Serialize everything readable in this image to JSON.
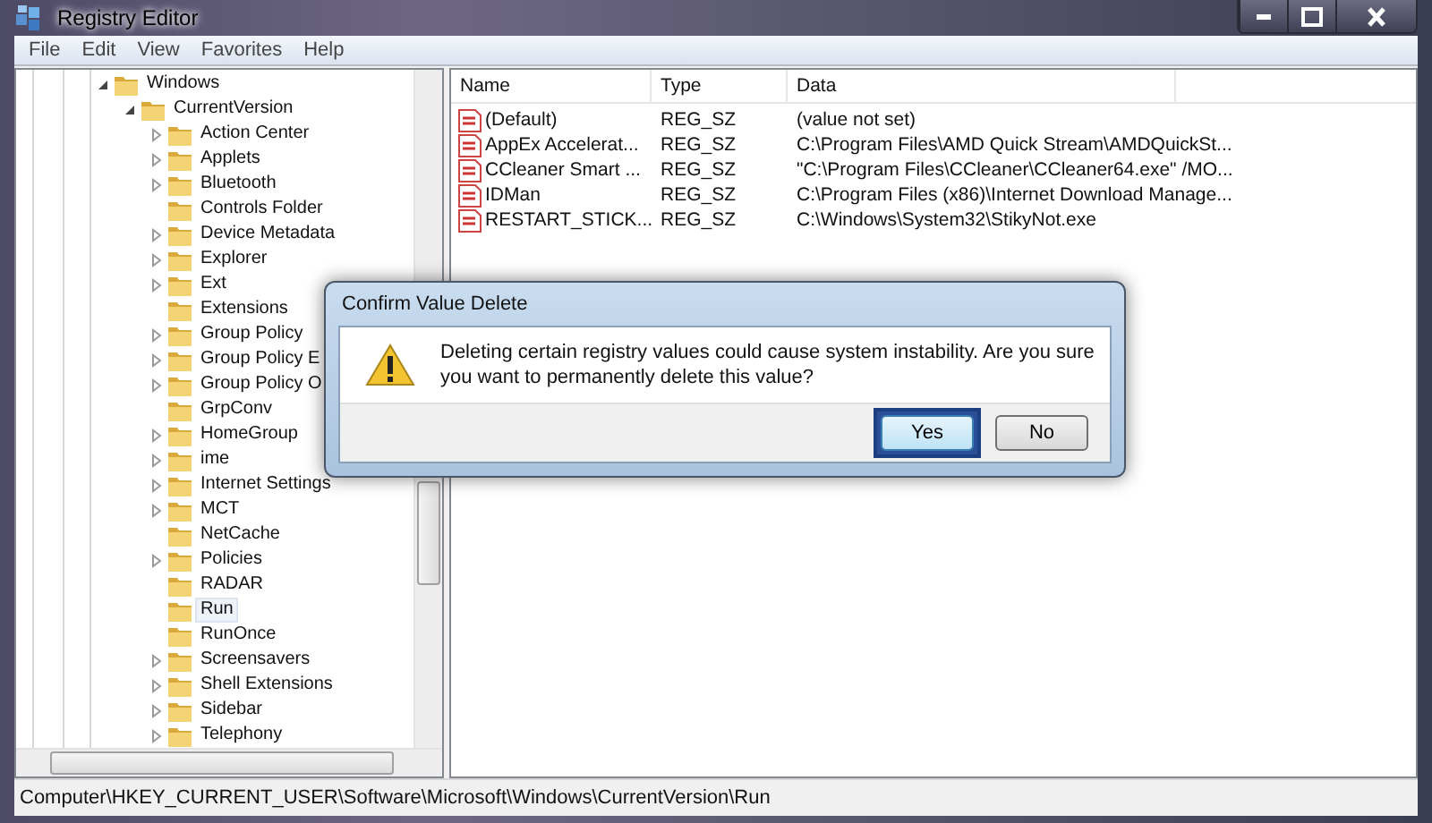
{
  "window": {
    "title": "Registry Editor"
  },
  "menu": [
    "File",
    "Edit",
    "View",
    "Favorites",
    "Help"
  ],
  "tree": [
    {
      "label": "Windows",
      "expanded": true,
      "selected": false,
      "children": [
        {
          "label": "CurrentVersion",
          "expanded": true,
          "selected": false,
          "children": [
            {
              "label": "Action Center",
              "expandable": true,
              "expanded": false,
              "selected": false
            },
            {
              "label": "Applets",
              "expandable": true,
              "expanded": false,
              "selected": false
            },
            {
              "label": "Bluetooth",
              "expandable": true,
              "expanded": false,
              "selected": false
            },
            {
              "label": "Controls Folder",
              "expandable": false,
              "expanded": false,
              "selected": false
            },
            {
              "label": "Device Metadata",
              "expandable": true,
              "expanded": false,
              "selected": false
            },
            {
              "label": "Explorer",
              "expandable": true,
              "expanded": false,
              "selected": false
            },
            {
              "label": "Ext",
              "expandable": true,
              "expanded": false,
              "selected": false
            },
            {
              "label": "Extensions",
              "expandable": false,
              "expanded": false,
              "selected": false
            },
            {
              "label": "Group Policy",
              "expandable": true,
              "expanded": false,
              "selected": false
            },
            {
              "label": "Group Policy E",
              "expandable": true,
              "expanded": false,
              "selected": false
            },
            {
              "label": "Group Policy O",
              "expandable": true,
              "expanded": false,
              "selected": false
            },
            {
              "label": "GrpConv",
              "expandable": false,
              "expanded": false,
              "selected": false
            },
            {
              "label": "HomeGroup",
              "expandable": true,
              "expanded": false,
              "selected": false
            },
            {
              "label": "ime",
              "expandable": true,
              "expanded": false,
              "selected": false
            },
            {
              "label": "Internet Settings",
              "expandable": true,
              "expanded": false,
              "selected": false
            },
            {
              "label": "MCT",
              "expandable": true,
              "expanded": false,
              "selected": false
            },
            {
              "label": "NetCache",
              "expandable": false,
              "expanded": false,
              "selected": false
            },
            {
              "label": "Policies",
              "expandable": true,
              "expanded": false,
              "selected": false
            },
            {
              "label": "RADAR",
              "expandable": false,
              "expanded": false,
              "selected": false
            },
            {
              "label": "Run",
              "expandable": false,
              "expanded": false,
              "selected": true
            },
            {
              "label": "RunOnce",
              "expandable": false,
              "expanded": false,
              "selected": false
            },
            {
              "label": "Screensavers",
              "expandable": true,
              "expanded": false,
              "selected": false
            },
            {
              "label": "Shell Extensions",
              "expandable": true,
              "expanded": false,
              "selected": false
            },
            {
              "label": "Sidebar",
              "expandable": true,
              "expanded": false,
              "selected": false
            },
            {
              "label": "Telephony",
              "expandable": true,
              "expanded": false,
              "selected": false
            }
          ]
        }
      ]
    }
  ],
  "values": {
    "columns": [
      "Name",
      "Type",
      "Data"
    ],
    "rows": [
      {
        "name": "(Default)",
        "type": "REG_SZ",
        "data": "(value not set)"
      },
      {
        "name": "AppEx Accelerat...",
        "type": "REG_SZ",
        "data": "C:\\Program Files\\AMD Quick Stream\\AMDQuickSt..."
      },
      {
        "name": "CCleaner Smart ...",
        "type": "REG_SZ",
        "data": "\"C:\\Program Files\\CCleaner\\CCleaner64.exe\" /MO..."
      },
      {
        "name": "IDMan",
        "type": "REG_SZ",
        "data": "C:\\Program Files (x86)\\Internet Download Manage..."
      },
      {
        "name": "RESTART_STICK...",
        "type": "REG_SZ",
        "data": "C:\\Windows\\System32\\StikyNot.exe"
      }
    ]
  },
  "dialog": {
    "title": "Confirm Value Delete",
    "message": "Deleting certain registry values could cause system instability. Are you sure you want to permanently delete this value?",
    "buttons": [
      {
        "label": "Yes",
        "focused": true
      },
      {
        "label": "No",
        "focused": false
      }
    ]
  },
  "status_bar": "Computer\\HKEY_CURRENT_USER\\Software\\Microsoft\\Windows\\CurrentVersion\\Run"
}
